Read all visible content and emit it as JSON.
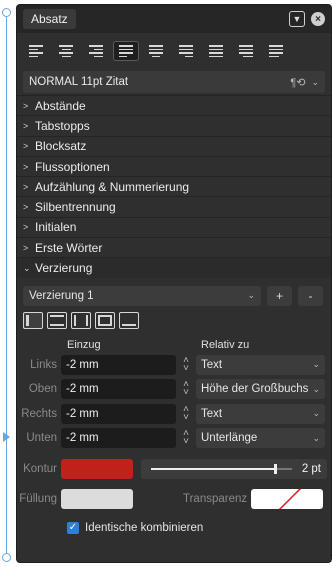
{
  "panel": {
    "tab_title": "Absatz",
    "menu_icon": "chevron-down-icon",
    "close_icon": "close-icon"
  },
  "alignment": {
    "buttons": [
      {
        "name": "align-left",
        "active": false
      },
      {
        "name": "align-center",
        "active": false
      },
      {
        "name": "align-right",
        "active": false
      },
      {
        "name": "justify-left",
        "active": true
      },
      {
        "name": "justify-center",
        "active": false
      },
      {
        "name": "justify-right",
        "active": false
      },
      {
        "name": "justify-all",
        "active": false
      },
      {
        "name": "align-toward-spine",
        "active": false
      },
      {
        "name": "align-away-from-spine",
        "active": false
      }
    ]
  },
  "style": {
    "value": "NORMAL 11pt Zitat",
    "pilcrow": "¶"
  },
  "sections": [
    {
      "label": "Abstände",
      "open": false
    },
    {
      "label": "Tabstopps",
      "open": false
    },
    {
      "label": "Blocksatz",
      "open": false
    },
    {
      "label": "Flussoptionen",
      "open": false
    },
    {
      "label": "Aufzählung & Nummerierung",
      "open": false
    },
    {
      "label": "Silbentrennung",
      "open": false
    },
    {
      "label": "Initialen",
      "open": false
    },
    {
      "label": "Erste Wörter",
      "open": false
    },
    {
      "label": "Verzierung",
      "open": true
    }
  ],
  "verzierung": {
    "selected": "Verzierung 1",
    "add_label": "+",
    "remove_label": "-",
    "border_styles": [
      "left",
      "top-bottom",
      "left-right",
      "box",
      "bottom"
    ],
    "header_indent": "Einzug",
    "header_relative": "Relativ zu",
    "rows": [
      {
        "label": "Links",
        "value": "-2 mm",
        "relative": "Text"
      },
      {
        "label": "Oben",
        "value": "-2 mm",
        "relative": "Höhe der Großbuchs"
      },
      {
        "label": "Rechts",
        "value": "-2 mm",
        "relative": "Text"
      },
      {
        "label": "Unten",
        "value": "-2 mm",
        "relative": "Unterlänge"
      }
    ],
    "stroke_label": "Kontur",
    "stroke_color": "#c0211b",
    "stroke_width": "2 pt",
    "stroke_width_fraction": 0.88,
    "fill_label": "Füllung",
    "fill_color": "#dcdcdc",
    "transparency_label": "Transparenz",
    "combine_label": "Identische kombinieren",
    "combine_checked": true
  }
}
